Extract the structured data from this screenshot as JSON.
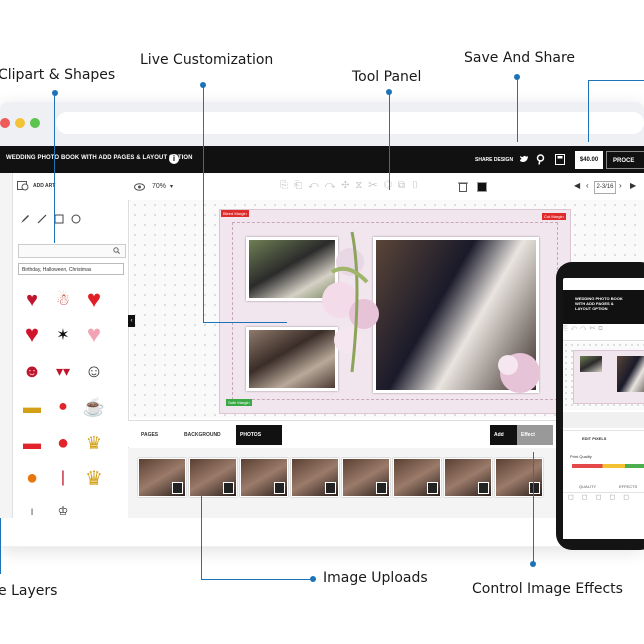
{
  "callouts": {
    "clipart": "Clipart & Shapes",
    "live": "Live Customization",
    "tool_panel": "Tool Panel",
    "save_share": "Save And Share",
    "layers": "e Layers",
    "image_uploads": "Image Uploads",
    "control_effects": "Control Image Effects"
  },
  "app": {
    "title": "WEDDING PHOTO BOOK WITH ADD PAGES & LAYOUT OPTION",
    "share_label": "SHARE DESIGN",
    "price": "$40.00",
    "proceed": "PROCE",
    "add_art": "ADD ART",
    "category": "Birthday, Halloween, Christmas",
    "zoom": "70%",
    "page_number": "2-3/16",
    "bleed_margin": "Bleed Margin",
    "cut_margin": "Cut Margin",
    "safe_margin": "Safe Margin"
  },
  "tabs": {
    "pages": "PAGES",
    "background": "BACKGROUND",
    "photos": "PHOTOS",
    "add": "Add",
    "effect": "Effect"
  },
  "phone": {
    "title": "WEDDING PHOTO BOOK WITH ADD PAGES & LAYOUT OPTION",
    "edit_pixels": "EDIT PIXELS",
    "print_quality": "Print Quality",
    "quality": "QUALITY",
    "effects": "EFFECTS"
  },
  "colors": {
    "accent": "#1e73b8",
    "topbar": "#111111",
    "margin_red": "#e02b2b",
    "margin_green": "#3aa845"
  }
}
